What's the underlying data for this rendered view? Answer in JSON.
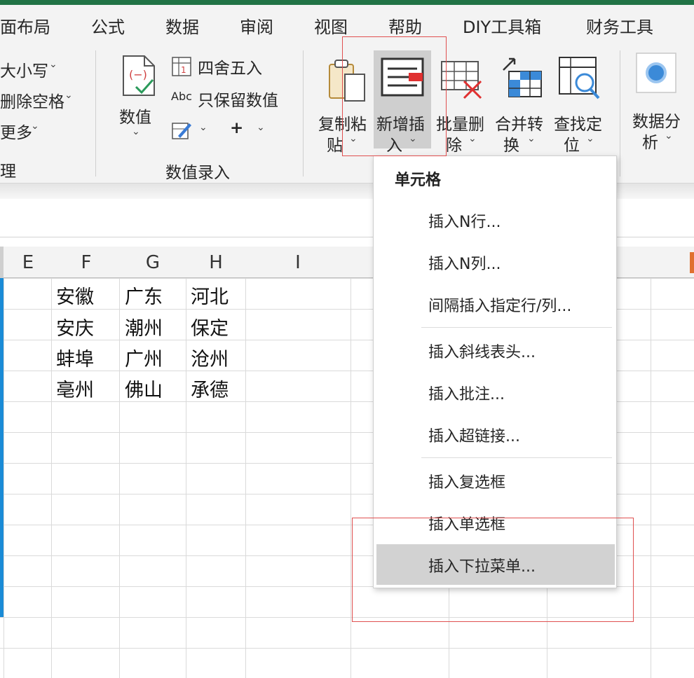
{
  "menubar": {
    "items": [
      "面布局",
      "公式",
      "数据",
      "审阅",
      "视图",
      "帮助",
      "DIY工具箱",
      "财务工具"
    ]
  },
  "ribbon": {
    "left_items": [
      "大小写",
      "删除空格",
      "更多"
    ],
    "left_group_label": "理",
    "shuzhi": {
      "label": "数值"
    },
    "sishewuru_label": "四舍五入",
    "abc_label": "只保留数值",
    "abc_glyph": "Abc",
    "plus_glyph": "+",
    "group_label": "数值录入",
    "buttons": [
      {
        "line1": "复制粘",
        "line2": "贴"
      },
      {
        "line1": "新增插",
        "line2": "入"
      },
      {
        "line1": "批量删",
        "line2": "除"
      },
      {
        "line1": "合并转",
        "line2": "换"
      },
      {
        "line1": "查找定",
        "line2": "位"
      },
      {
        "line1": "数据分",
        "line2": "析"
      }
    ],
    "chevron": "⌄"
  },
  "sheet": {
    "columns": [
      "E",
      "F",
      "G",
      "H",
      "I"
    ],
    "rows": [
      [
        "安徽",
        "广东",
        "河北"
      ],
      [
        "安庆",
        "潮州",
        "保定"
      ],
      [
        "蚌埠",
        "广州",
        "沧州"
      ],
      [
        "亳州",
        "佛山",
        "承德"
      ]
    ]
  },
  "dropdown": {
    "header": "单元格",
    "items": [
      "插入N行...",
      "插入N列...",
      "间隔插入指定行/列...",
      "插入斜线表头...",
      "插入批注...",
      "插入超链接...",
      "插入复选框",
      "插入单选框",
      "插入下拉菜单..."
    ]
  },
  "colors": {
    "accent_green": "#217346",
    "highlight_box": "#e05050",
    "selected_col": "#e07030",
    "selection_border": "#1a8bd6"
  }
}
